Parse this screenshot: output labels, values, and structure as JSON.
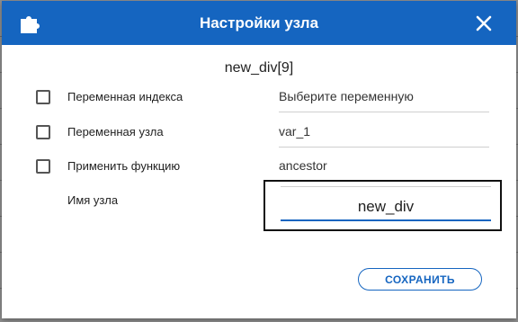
{
  "dialog": {
    "title": "Настройки узла",
    "app_icon": "puzzle-icon",
    "close_icon": "close-icon",
    "node_title": "new_div[9]",
    "rows": [
      {
        "label": "Переменная индекса",
        "value": "Выберите переменную",
        "checked": false
      },
      {
        "label": "Переменная узла",
        "value": "var_1",
        "checked": false
      },
      {
        "label": "Применить функцию",
        "value": "ancestor",
        "checked": false
      }
    ],
    "node_name": {
      "label": "Имя узла",
      "value": "new_div"
    },
    "save_label": "СОХРАНИТЬ"
  },
  "colors": {
    "accent": "#1565c0",
    "header_text": "#ffffff"
  }
}
